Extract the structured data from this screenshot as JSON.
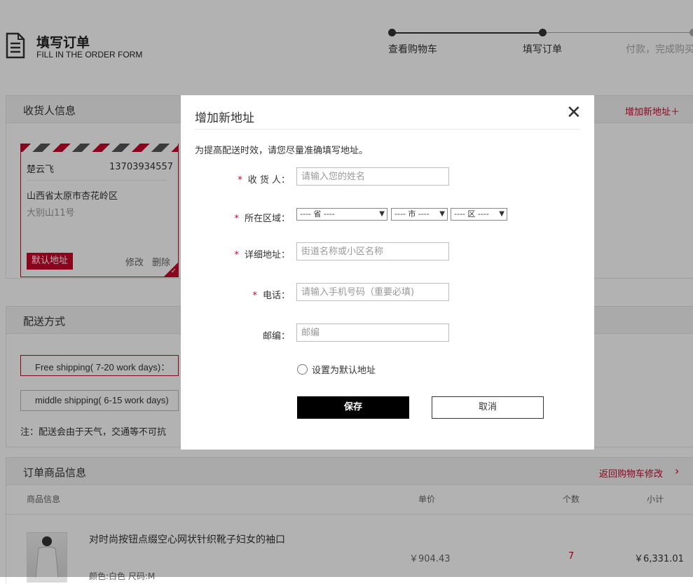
{
  "header": {
    "title_cn": "填写订单",
    "title_en": "FILL IN THE ORDER FORM",
    "steps": [
      "查看购物车",
      "填写订单",
      "付款，完成购买"
    ]
  },
  "consignee": {
    "title": "收货人信息",
    "add_link": "增加新地址＋",
    "card": {
      "name": "楚云飞",
      "phone": "13703934557",
      "address_line1": "山西省太原市杏花岭区",
      "address_line2": "大别山11号",
      "default_badge": "默认地址",
      "edit": "修改",
      "delete": "删除"
    }
  },
  "shipping": {
    "title": "配送方式",
    "options": [
      "Free shipping( 7-20 work days)：",
      "middle shipping( 6-15 work days)"
    ],
    "note": "注：配送会由于天气，交通等不可抗"
  },
  "order_items": {
    "title": "订单商品信息",
    "back_link": "返回购物车修改",
    "columns": [
      "商品信息",
      "单价",
      "个数",
      "小计"
    ],
    "item": {
      "name": "对时尚按钮点缀空心网状针织靴子妇女的袖口",
      "attrs": "颜色:白色 尺码:M",
      "unit_price": "￥904.43",
      "qty": "7",
      "subtotal": "￥6,331.01"
    }
  },
  "modal": {
    "title": "增加新地址",
    "close": "✕",
    "note": "为提高配送时效，请您尽量准确填写地址。",
    "fields": {
      "name_label": "收 货 人：",
      "name_placeholder": "请输入您的姓名",
      "region_label": "所在区域：",
      "province": "---- 省 ----",
      "city": "---- 市 ----",
      "district": "---- 区 ----",
      "address_label": "详细地址：",
      "address_placeholder": "街道名称或小区名称",
      "phone_label": "电话：",
      "phone_placeholder": "请输入手机号码（重要必填)",
      "zip_label": "邮编：",
      "zip_placeholder": "邮编"
    },
    "default_checkbox_label": "设置为默认地址",
    "save": "保存",
    "cancel": "取消"
  },
  "colors": {
    "accent": "#c6072b",
    "overlay": "rgba(0,0,0,0.3)"
  }
}
